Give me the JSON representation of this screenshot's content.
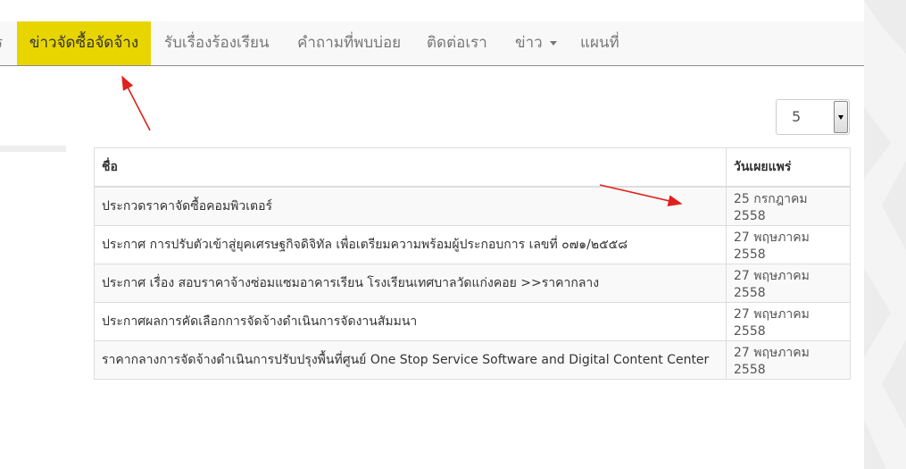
{
  "navbar": {
    "items": [
      {
        "label": "ร"
      },
      {
        "label": "ข่าวจัดซื้อจัดจ้าง",
        "active": true
      },
      {
        "label": "รับเรื่องร้องเรียน"
      },
      {
        "label": "คำถามที่พบบ่อย"
      },
      {
        "label": "ติดต่อเรา"
      },
      {
        "label": "ข่าว",
        "has_caret": true
      },
      {
        "label": "แผนที่"
      }
    ],
    "active_color": "#e8d500"
  },
  "page_size": {
    "value": "5"
  },
  "table": {
    "headers": {
      "name": "ชื่อ",
      "date": "วันเผยแพร่"
    },
    "rows": [
      {
        "title": "ประกวดราคาจัดซื้อคอมพิวเตอร์",
        "date": "25 กรกฎาคม 2558"
      },
      {
        "title": "ประกาศ การปรับตัวเข้าสู่ยุคเศรษฐกิจดิจิทัล เพื่อเตรียมความพร้อมผู้ประกอบการ เลขที่ ๐๗๑/๒๕๕๘",
        "date": "27 พฤษภาคม 2558"
      },
      {
        "title": "ประกาศ เรื่อง สอบราคาจ้างซ่อมแซมอาคารเรียน โรงเรียนเทศบาลวัดแก่งคอย >>ราคากลาง",
        "date": "27 พฤษภาคม 2558"
      },
      {
        "title": "ประกาศผลการคัดเลือกการจัดจ้างดำเนินการจัดงานสัมมนา",
        "date": "27 พฤษภาคม 2558"
      },
      {
        "title": "ราคากลางการจัดจ้างดำเนินการปรับปรุงพื้นที่ศูนย์ One Stop Service Software and Digital Content Center",
        "date": "27 พฤษภาคม 2558"
      }
    ]
  },
  "annotation_color": "#e0201b"
}
